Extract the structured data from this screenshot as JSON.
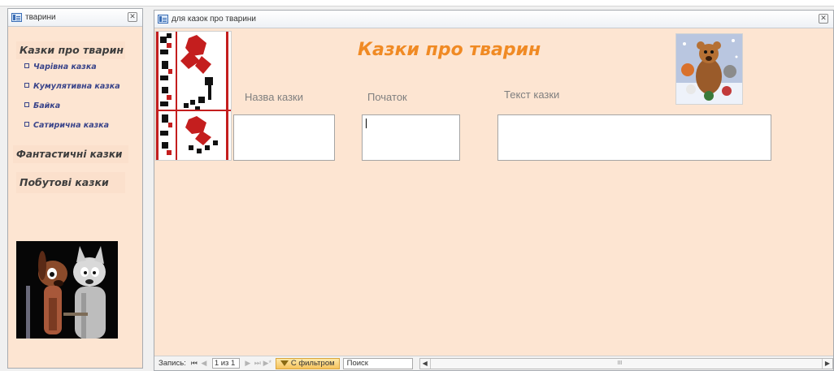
{
  "left_window": {
    "title": "тварини",
    "close_glyph": "✕",
    "nav": {
      "animal_tales": "Казки про тварин",
      "sub_items": [
        "Чарівна казка",
        "Кумулятивна казка",
        "Байка",
        "Сатирична казка"
      ],
      "fantastic_tales": "Фантастичні казки",
      "everyday_tales": "Побутові казки"
    },
    "image_icon": "cartoon-dog-and-wolf-image"
  },
  "main_window": {
    "title": "для казок про тварини",
    "close_glyph": "✕",
    "form": {
      "title": "Казки про тварин",
      "labels": {
        "name": "Назва казки",
        "beginning": "Початок",
        "text": "Текст казки"
      },
      "values": {
        "name": "",
        "beginning": "",
        "text": ""
      },
      "image_icon": "cartoon-animals-image",
      "ornament_icon": "embroidery-ornament-image"
    },
    "status": {
      "record_label": "Запись:",
      "first_glyph": "⏮",
      "prev_glyph": "◀",
      "record_value": "1 из 1",
      "next_glyph": "▶",
      "last_glyph": "⏭",
      "new_glyph": "▶*",
      "filter_label": "С фильтром",
      "search_placeholder": "Поиск",
      "scroll_left": "◀",
      "scroll_grip": "III",
      "scroll_right": "▶"
    }
  },
  "colors": {
    "form_bg": "#fde5d2",
    "title_accent": "#f08a24",
    "nav_sub_text": "#39448a"
  }
}
